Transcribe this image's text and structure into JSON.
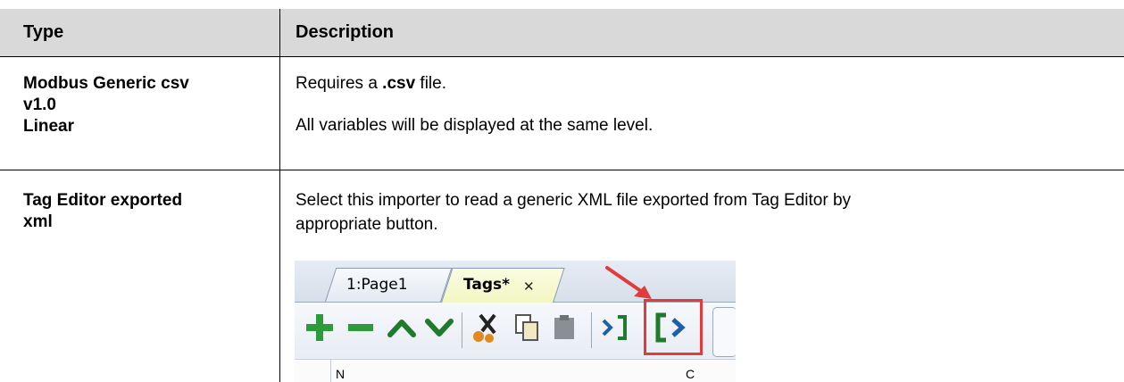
{
  "table": {
    "headers": {
      "type": "Type",
      "description": "Description"
    },
    "rows": [
      {
        "type_lines": [
          "Modbus Generic csv",
          "v1.0",
          "Linear"
        ],
        "desc_prefix": "Requires a ",
        "desc_bold": ".csv",
        "desc_suffix": " file.",
        "desc_line2": "All variables will be displayed at the same level."
      },
      {
        "type_lines": [
          "Tag Editor exported",
          "xml"
        ],
        "desc_lines": [
          "Select this importer to read a generic XML file exported from Tag Editor by",
          "appropriate button."
        ]
      }
    ]
  },
  "screenshot": {
    "tabs": [
      {
        "label": "1:Page1"
      },
      {
        "label": "Tags*",
        "close": "✕"
      }
    ],
    "toolbar_icons": [
      "add-icon",
      "remove-icon",
      "move-up-icon",
      "move-down-icon",
      "cut-icon",
      "copy-icon",
      "paste-icon",
      "import-icon",
      "export-icon"
    ],
    "grid_header_fragments": [
      "N",
      "C"
    ],
    "colors": {
      "add": "#2e9a3a",
      "arrows": "#1f7a2c",
      "highlight": "#e23b3b"
    }
  }
}
